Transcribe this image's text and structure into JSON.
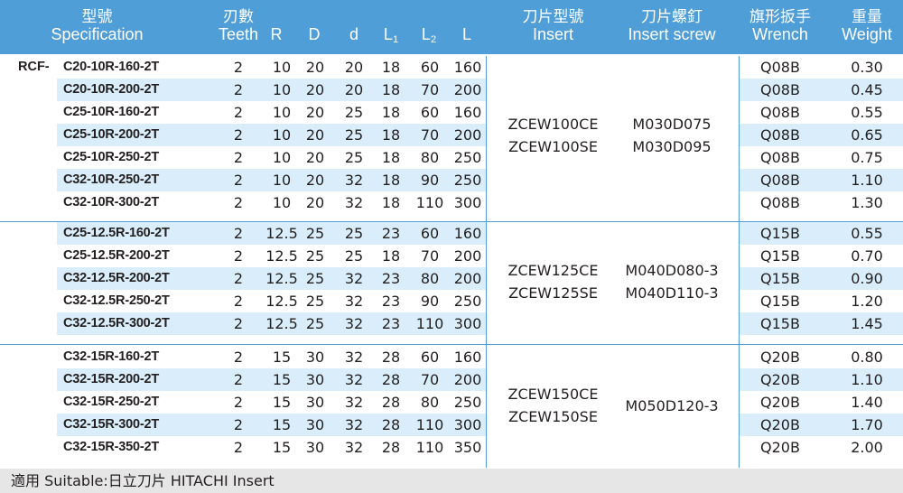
{
  "headers": {
    "spec_zh": "型號",
    "spec_en": "Specification",
    "teeth_zh": "刃數",
    "teeth_en": "Teeth",
    "r": "R",
    "d_upper": "D",
    "d_lower": "d",
    "l1_main": "L",
    "l1_sub": "1",
    "l2_main": "L",
    "l2_sub": "2",
    "l": "L",
    "insert_zh": "刀片型號",
    "insert_en": "Insert",
    "screw_zh": "刀片螺釘",
    "screw_en": "Insert screw",
    "wrench_zh": "旗形扳手",
    "wrench_en": "Wrench",
    "weight_zh": "重量",
    "weight_en": "Weight"
  },
  "prefix": "RCF-",
  "rows": [
    {
      "spec": "C20-10R-160-2T",
      "teeth": "2",
      "r": "10",
      "D": "20",
      "d": "20",
      "l1": "18",
      "l2": "60",
      "l": "160",
      "wrench": "Q08B",
      "weight": "0.30"
    },
    {
      "spec": "C20-10R-200-2T",
      "teeth": "2",
      "r": "10",
      "D": "20",
      "d": "20",
      "l1": "18",
      "l2": "70",
      "l": "200",
      "wrench": "Q08B",
      "weight": "0.45"
    },
    {
      "spec": "C25-10R-160-2T",
      "teeth": "2",
      "r": "10",
      "D": "20",
      "d": "25",
      "l1": "18",
      "l2": "60",
      "l": "160",
      "wrench": "Q08B",
      "weight": "0.55"
    },
    {
      "spec": "C25-10R-200-2T",
      "teeth": "2",
      "r": "10",
      "D": "20",
      "d": "25",
      "l1": "18",
      "l2": "70",
      "l": "200",
      "wrench": "Q08B",
      "weight": "0.65"
    },
    {
      "spec": "C25-10R-250-2T",
      "teeth": "2",
      "r": "10",
      "D": "20",
      "d": "25",
      "l1": "18",
      "l2": "80",
      "l": "250",
      "wrench": "Q08B",
      "weight": "0.75"
    },
    {
      "spec": "C32-10R-250-2T",
      "teeth": "2",
      "r": "10",
      "D": "20",
      "d": "32",
      "l1": "18",
      "l2": "90",
      "l": "250",
      "wrench": "Q08B",
      "weight": "1.10"
    },
    {
      "spec": "C32-10R-300-2T",
      "teeth": "2",
      "r": "10",
      "D": "20",
      "d": "32",
      "l1": "18",
      "l2": "110",
      "l": "300",
      "wrench": "Q08B",
      "weight": "1.30"
    },
    {
      "spec": "C25-12.5R-160-2T",
      "teeth": "2",
      "r": "12.5",
      "D": "25",
      "d": "25",
      "l1": "23",
      "l2": "60",
      "l": "160",
      "wrench": "Q15B",
      "weight": "0.55"
    },
    {
      "spec": "C25-12.5R-200-2T",
      "teeth": "2",
      "r": "12.5",
      "D": "25",
      "d": "25",
      "l1": "18",
      "l2": "70",
      "l": "200",
      "wrench": "Q15B",
      "weight": "0.70"
    },
    {
      "spec": "C32-12.5R-200-2T",
      "teeth": "2",
      "r": "12.5",
      "D": "25",
      "d": "32",
      "l1": "23",
      "l2": "80",
      "l": "200",
      "wrench": "Q15B",
      "weight": "0.90"
    },
    {
      "spec": "C32-12.5R-250-2T",
      "teeth": "2",
      "r": "12.5",
      "D": "25",
      "d": "32",
      "l1": "23",
      "l2": "90",
      "l": "250",
      "wrench": "Q15B",
      "weight": "1.20"
    },
    {
      "spec": "C32-12.5R-300-2T",
      "teeth": "2",
      "r": "12.5",
      "D": "25",
      "d": "32",
      "l1": "23",
      "l2": "110",
      "l": "300",
      "wrench": "Q15B",
      "weight": "1.45"
    },
    {
      "spec": "C32-15R-160-2T",
      "teeth": "2",
      "r": "15",
      "D": "30",
      "d": "32",
      "l1": "28",
      "l2": "60",
      "l": "160",
      "wrench": "Q20B",
      "weight": "0.80"
    },
    {
      "spec": "C32-15R-200-2T",
      "teeth": "2",
      "r": "15",
      "D": "30",
      "d": "32",
      "l1": "28",
      "l2": "70",
      "l": "200",
      "wrench": "Q20B",
      "weight": "1.10"
    },
    {
      "spec": "C32-15R-250-2T",
      "teeth": "2",
      "r": "15",
      "D": "30",
      "d": "32",
      "l1": "28",
      "l2": "80",
      "l": "250",
      "wrench": "Q20B",
      "weight": "1.40"
    },
    {
      "spec": "C32-15R-300-2T",
      "teeth": "2",
      "r": "15",
      "D": "30",
      "d": "32",
      "l1": "28",
      "l2": "110",
      "l": "300",
      "wrench": "Q20B",
      "weight": "1.70"
    },
    {
      "spec": "C32-15R-350-2T",
      "teeth": "2",
      "r": "15",
      "D": "30",
      "d": "32",
      "l1": "28",
      "l2": "110",
      "l": "350",
      "wrench": "Q20B",
      "weight": "2.00"
    }
  ],
  "groups": [
    {
      "insert_1": "ZCEW100CE",
      "insert_2": "ZCEW100SE",
      "screw_1": "M030D075",
      "screw_2": "M030D095"
    },
    {
      "insert_1": "ZCEW125CE",
      "insert_2": "ZCEW125SE",
      "screw_1": "M040D080-3",
      "screw_2": "M040D110-3"
    },
    {
      "insert_1": "ZCEW150CE",
      "insert_2": "ZCEW150SE",
      "screw_1": "M050D120-3",
      "screw_2": ""
    }
  ],
  "footer": "適用 Suitable:日立刀片 HITACHI Insert",
  "colors": {
    "header_bg": "#4f9ed8",
    "band_bg": "#d9eefa",
    "footer_bg": "#e6e6e6",
    "text": "#231f20"
  }
}
